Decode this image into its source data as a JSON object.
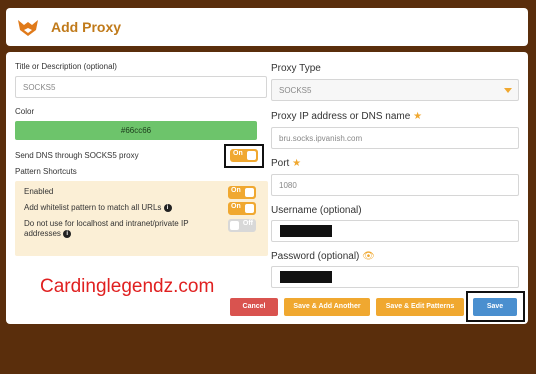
{
  "header": {
    "title": "Add Proxy",
    "logo_icon": "fox-logo-icon"
  },
  "left": {
    "title_label": "Title or Description (optional)",
    "title_value": "SOCKS5",
    "color_label": "Color",
    "color_value": "#66cc66",
    "send_dns_label": "Send DNS through SOCKS5 proxy",
    "send_dns_toggle": "On",
    "pattern_shortcuts_label": "Pattern Shortcuts",
    "enabled_label": "Enabled",
    "enabled_toggle": "On",
    "whitelist_label": "Add whitelist pattern to match all URLs",
    "whitelist_toggle": "On",
    "localhost_label_1": "Do not use for localhost and intranet/private IP",
    "localhost_label_2": "addresses",
    "localhost_toggle": "Off"
  },
  "right": {
    "proxy_type_label": "Proxy Type",
    "proxy_type_value": "SOCKS5",
    "ip_label": "Proxy IP address or DNS name",
    "ip_value": "bru.socks.ipvanish.com",
    "port_label": "Port",
    "port_value": "1080",
    "username_label": "Username (optional)",
    "password_label": "Password (optional)"
  },
  "buttons": {
    "cancel": "Cancel",
    "save_add": "Save & Add Another",
    "save_edit": "Save & Edit Patterns",
    "save": "Save"
  },
  "watermark": "Cardinglegendz.com",
  "colors": {
    "accent": "#f0a830",
    "header_title": "#c07a1a",
    "green": "#6dc46b",
    "cancel": "#d9534f",
    "save": "#4a8fcf",
    "background": "#5a2e0c"
  }
}
